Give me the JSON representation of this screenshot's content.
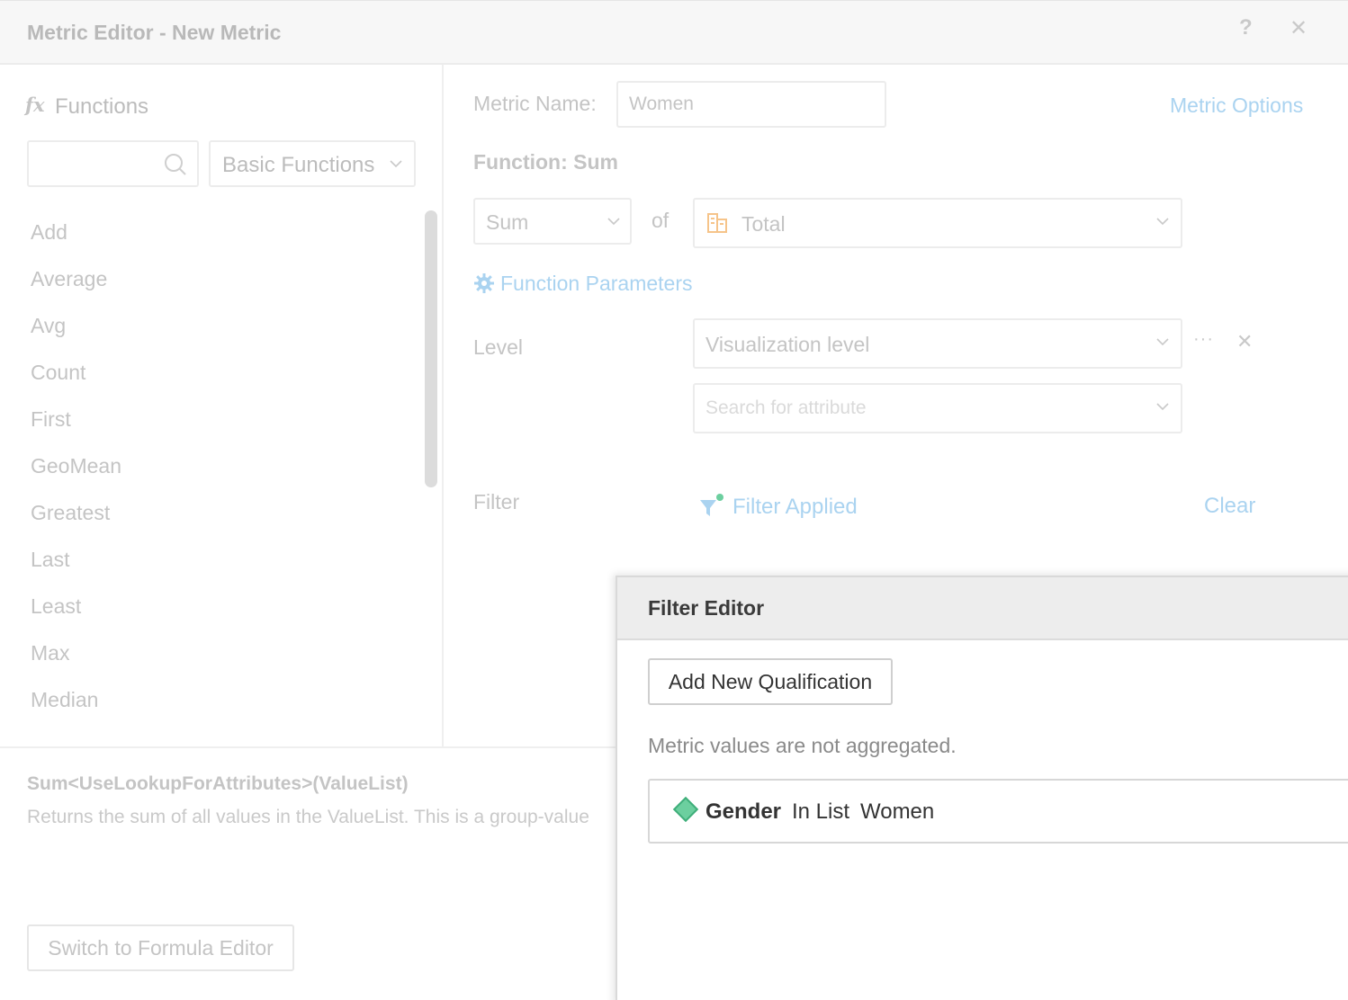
{
  "dialog": {
    "title": "Metric Editor - New Metric",
    "help": "?",
    "close": "✕"
  },
  "functions_panel": {
    "heading_icon": "fx",
    "heading": "Functions",
    "search_placeholder": "",
    "category": "Basic Functions",
    "items": [
      "Add",
      "Average",
      "Avg",
      "Count",
      "First",
      "GeoMean",
      "Greatest",
      "Last",
      "Least",
      "Max",
      "Median"
    ]
  },
  "description": {
    "signature": "Sum<UseLookupForAttributes>(ValueList)",
    "text": "Returns the sum of all values in the ValueList. This is a group-value"
  },
  "switch_button": "Switch to Formula Editor",
  "metric": {
    "name_label": "Metric Name:",
    "name_value": "Women",
    "options_link": "Metric Options",
    "function_heading": "Function: Sum",
    "function_select": "Sum",
    "of_label": "of",
    "target_select": "Total",
    "params_link": "Function Parameters",
    "level_label": "Level",
    "level_select": "Visualization level",
    "attribute_placeholder": "Search for attribute",
    "more": "···",
    "remove": "✕",
    "filter_label": "Filter",
    "filter_status": "Filter Applied",
    "clear_link": "Clear"
  },
  "filter_editor": {
    "title": "Filter Editor",
    "add_button": "Add New Qualification",
    "note": "Metric values are not aggregated.",
    "qualification": {
      "attribute": "Gender",
      "operator": "In List",
      "value": "Women"
    }
  },
  "colors": {
    "link": "#aad3f0",
    "qualification_diamond": "#6ccf9f",
    "total_icon": "#f6c48a"
  }
}
